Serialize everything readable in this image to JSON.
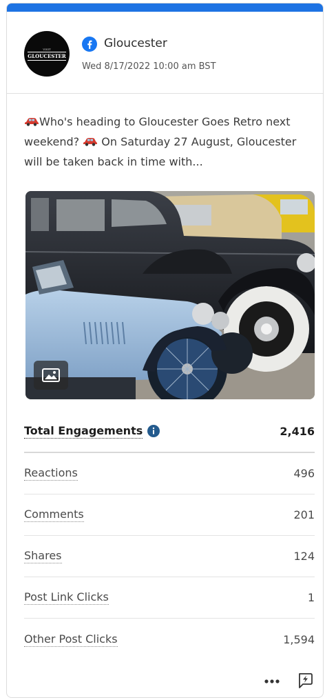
{
  "post": {
    "page_name": "Gloucester",
    "network_icon": "facebook-icon",
    "avatar_text_small": "VISIT",
    "avatar_text": "GLOUCESTER",
    "date": "Wed 8/17/2022 10:00 am BST",
    "text_1": "Who's heading to Gloucester Goes Retro next weekend?",
    "text_2": " On Saturday 27 August, Gloucester will be taken back in time with...",
    "image_icon": "image-icon"
  },
  "metrics": {
    "total_label": "Total Engagements",
    "total_value": "2,416",
    "rows": [
      {
        "label": "Reactions",
        "value": "496"
      },
      {
        "label": "Comments",
        "value": "201"
      },
      {
        "label": "Shares",
        "value": "124"
      },
      {
        "label": "Post Link Clicks",
        "value": "1"
      },
      {
        "label": "Other Post Clicks",
        "value": "1,594"
      }
    ]
  },
  "colors": {
    "accent": "#1e73e3",
    "facebook": "#1877f2",
    "info": "#245b8e"
  }
}
